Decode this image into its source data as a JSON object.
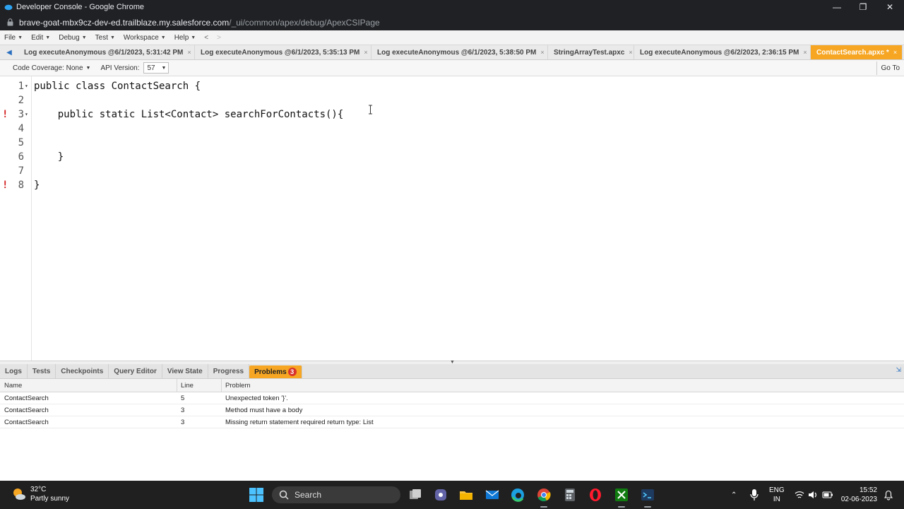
{
  "window": {
    "title": "Developer Console - Google Chrome",
    "controls": {
      "minimize": "—",
      "restore": "❐",
      "close": "✕"
    }
  },
  "address": {
    "host": "brave-goat-mbx9cz-dev-ed.trailblaze.my.salesforce.com",
    "path": "/_ui/common/apex/debug/ApexCSIPage"
  },
  "menu": {
    "items": [
      "File",
      "Edit",
      "Debug",
      "Test",
      "Workspace",
      "Help"
    ],
    "back": "<",
    "forward": ">"
  },
  "tabs": [
    {
      "label": "Log executeAnonymous @6/1/2023, 5:31:42 PM",
      "close": "×"
    },
    {
      "label": "Log executeAnonymous @6/1/2023, 5:35:13 PM",
      "close": "×"
    },
    {
      "label": "Log executeAnonymous @6/1/2023, 5:38:50 PM",
      "close": "×"
    },
    {
      "label": "StringArrayTest.apxc",
      "close": "×"
    },
    {
      "label": "Log executeAnonymous @6/2/2023, 2:36:15 PM",
      "close": "×"
    },
    {
      "label": "ContactSearch.apxc *",
      "close": "×"
    }
  ],
  "toolbar": {
    "coverage": "Code Coverage: None",
    "api_label": "API Version:",
    "api_value": "57",
    "goto": "Go To"
  },
  "code": {
    "lines": [
      {
        "num": "1",
        "text": "public class ContactSearch {",
        "error": false,
        "fold": true
      },
      {
        "num": "2",
        "text": "",
        "error": false,
        "fold": false
      },
      {
        "num": "3",
        "text": "    public static List<Contact> searchForContacts(){",
        "error": true,
        "fold": true
      },
      {
        "num": "4",
        "text": "",
        "error": false,
        "fold": false
      },
      {
        "num": "5",
        "text": "",
        "error": false,
        "fold": false
      },
      {
        "num": "6",
        "text": "    }",
        "error": false,
        "fold": false
      },
      {
        "num": "7",
        "text": "",
        "error": false,
        "fold": false
      },
      {
        "num": "8",
        "text": "}",
        "error": true,
        "fold": false
      }
    ],
    "error_marker": "!",
    "fold_marker": "▾"
  },
  "panel": {
    "tabs": [
      "Logs",
      "Tests",
      "Checkpoints",
      "Query Editor",
      "View State",
      "Progress"
    ],
    "active_tab": "Problems",
    "problem_count": "3"
  },
  "problems": {
    "headers": {
      "name": "Name",
      "line": "Line",
      "problem": "Problem"
    },
    "rows": [
      {
        "name": "ContactSearch",
        "line": "5",
        "problem": "Unexpected token '}'."
      },
      {
        "name": "ContactSearch",
        "line": "3",
        "problem": "Method must have a body"
      },
      {
        "name": "ContactSearch",
        "line": "3",
        "problem": "Missing return statement required return type: List"
      }
    ]
  },
  "taskbar": {
    "weather_temp": "32°C",
    "weather_desc": "Partly sunny",
    "search_label": "Search",
    "lang_top": "ENG",
    "lang_bottom": "IN",
    "time": "15:52",
    "date": "02-06-2023"
  },
  "colors": {
    "accent_tab": "#f6a623",
    "error": "#d32020",
    "badge": "#d9342b"
  }
}
